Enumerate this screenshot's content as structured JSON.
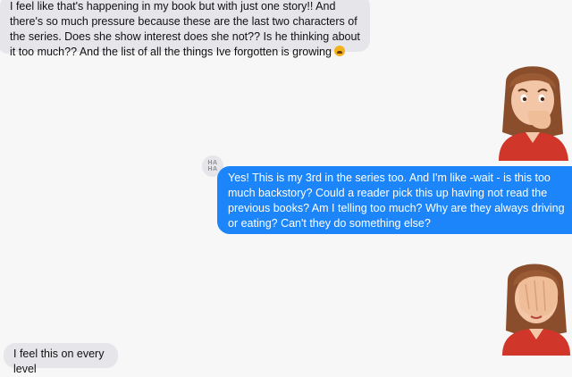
{
  "messages": [
    {
      "direction": "incoming",
      "text": "I feel like that's happening in my book but with just one story!! And there's so much pressure because these are the last two characters of the series. Does she show interest does she not?? Is he thinking about it too much?? And the list of all the things Ive forgotten is growing",
      "emoji": "weary-face-emoji"
    },
    {
      "direction": "incoming",
      "sticker": "memoji-nervous-biting-nails"
    },
    {
      "direction": "outgoing",
      "text": "Yes! This is my 3rd in the series too. And I'm like -wait - is this too much backstory? Could a reader pick this up having not read the previous books? Am I telling too much? Why are they always driving or eating? Can't they do something else?",
      "tapback": {
        "label_line1": "HA",
        "label_line2": "HA"
      }
    },
    {
      "direction": "incoming",
      "sticker": "memoji-facepalm"
    },
    {
      "direction": "incoming",
      "text": "I feel this on every level"
    }
  ],
  "colors": {
    "background": "#f7f7f8",
    "incoming_bubble": "#e5e5ea",
    "outgoing_bubble": "#1b85f9"
  }
}
